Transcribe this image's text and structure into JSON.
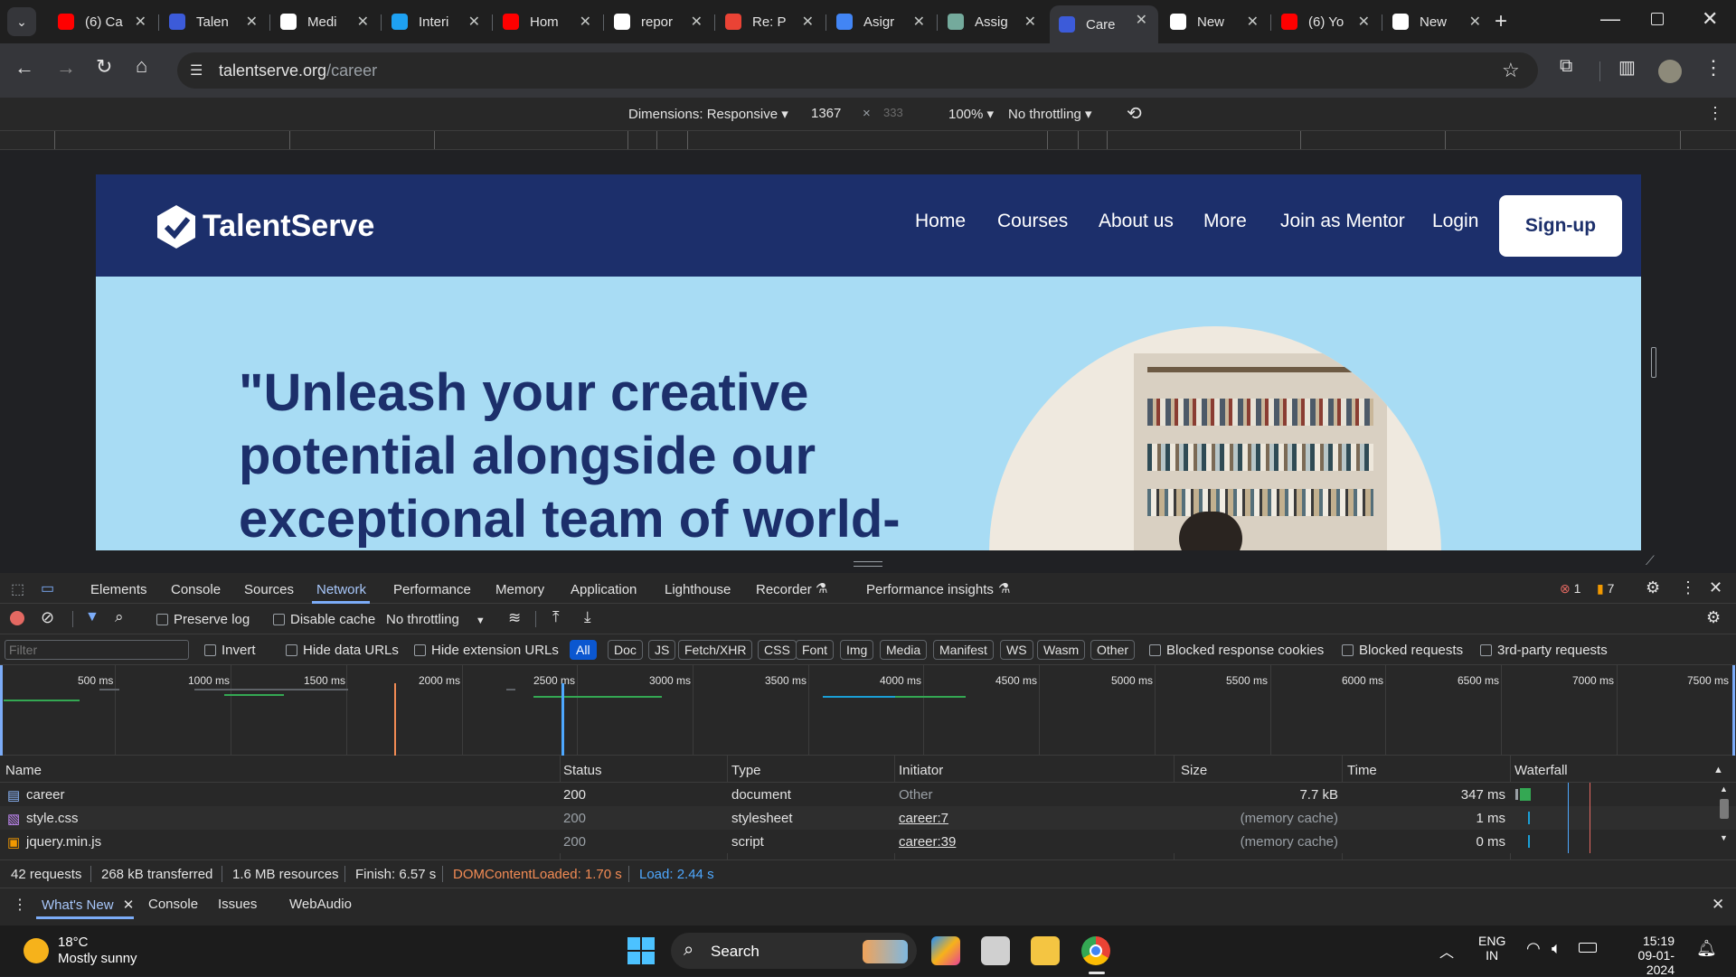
{
  "browser": {
    "tabs": [
      {
        "label": "(6) Ca",
        "icon": "youtube-icon",
        "color": "#ff0000"
      },
      {
        "label": "Talen",
        "icon": "talentserve-icon",
        "color": "#3c5bd9"
      },
      {
        "label": "Medi",
        "icon": "medium-icon",
        "color": "#ffffff"
      },
      {
        "label": "Interi",
        "icon": "internshala-icon",
        "color": "#1ea1f2"
      },
      {
        "label": "Hom",
        "icon": "youtube-icon",
        "color": "#ff0000"
      },
      {
        "label": "repor",
        "icon": "google-icon",
        "color": "#ffffff"
      },
      {
        "label": "Re: P",
        "icon": "gmail-icon",
        "color": "#ea4335"
      },
      {
        "label": "Asigr",
        "icon": "docs-icon",
        "color": "#4285f4"
      },
      {
        "label": "Assig",
        "icon": "chatgpt-icon",
        "color": "#74aa9c"
      },
      {
        "label": "Care",
        "icon": "talentserve-icon",
        "color": "#3c5bd9",
        "active": true
      },
      {
        "label": "New",
        "icon": "chrome-icon",
        "color": "#ffffff"
      },
      {
        "label": "(6) Yo",
        "icon": "youtube-icon",
        "color": "#ff0000"
      },
      {
        "label": "New",
        "icon": "chrome-icon",
        "color": "#ffffff"
      }
    ],
    "url_domain": "talentserve.org",
    "url_path": "/career"
  },
  "device_toolbar": {
    "dimensions": "Dimensions: Responsive ▾",
    "width": "1367",
    "times": "×",
    "height_placeholder": "333",
    "zoom": "100% ▾",
    "throttle": "No throttling ▾"
  },
  "site": {
    "brand": "TalentServe",
    "nav": [
      "Home",
      "Courses",
      "About us",
      "More",
      "Join as Mentor",
      "Login"
    ],
    "signup": "Sign-up",
    "hero_line1": "\"Unleash your creative",
    "hero_line2": "potential alongside our",
    "hero_line3": "exceptional team of world-"
  },
  "devtools": {
    "tabs": [
      "Elements",
      "Console",
      "Sources",
      "Network",
      "Performance",
      "Memory",
      "Application",
      "Lighthouse",
      "Recorder",
      "Performance insights"
    ],
    "active_tab": "Network",
    "errors": "1",
    "warnings": "7",
    "toolbar": {
      "preserve_log": "Preserve log",
      "disable_cache": "Disable cache",
      "throttling": "No throttling"
    },
    "filter": {
      "placeholder": "Filter",
      "invert": "Invert",
      "hide_data": "Hide data URLs",
      "hide_ext": "Hide extension URLs",
      "types": [
        "All",
        "Doc",
        "JS",
        "Fetch/XHR",
        "CSS",
        "Font",
        "Img",
        "Media",
        "Manifest",
        "WS",
        "Wasm",
        "Other"
      ],
      "blocked_cookies": "Blocked response cookies",
      "blocked_requests": "Blocked requests",
      "third_party": "3rd-party requests"
    },
    "timeline_labels": [
      "500 ms",
      "1000 ms",
      "1500 ms",
      "2000 ms",
      "2500 ms",
      "3000 ms",
      "3500 ms",
      "4000 ms",
      "4500 ms",
      "5000 ms",
      "5500 ms",
      "6000 ms",
      "6500 ms",
      "7000 ms",
      "7500 ms"
    ],
    "columns": [
      "Name",
      "Status",
      "Type",
      "Initiator",
      "Size",
      "Time",
      "Waterfall"
    ],
    "rows": [
      {
        "name": "career",
        "status": "200",
        "type": "document",
        "initiator": "Other",
        "size": "7.7 kB",
        "time": "347 ms",
        "icon": "document-icon"
      },
      {
        "name": "style.css",
        "status": "200",
        "type": "stylesheet",
        "initiator": "career:7",
        "size": "(memory cache)",
        "time": "1 ms",
        "icon": "css-file-icon"
      },
      {
        "name": "jquery.min.js",
        "status": "200",
        "type": "script",
        "initiator": "career:39",
        "size": "(memory cache)",
        "time": "0 ms",
        "icon": "js-file-icon"
      }
    ],
    "summary": {
      "requests": "42 requests",
      "transferred": "268 kB transferred",
      "resources": "1.6 MB resources",
      "finish": "Finish: 6.57 s",
      "dcl": "DOMContentLoaded: 1.70 s",
      "load": "Load: 2.44 s"
    },
    "drawer_tabs": [
      "What's New",
      "Console",
      "Issues",
      "WebAudio"
    ]
  },
  "taskbar": {
    "temp": "18°C",
    "weather": "Mostly sunny",
    "search": "Search",
    "lang1": "ENG",
    "lang2": "IN",
    "time": "15:19",
    "date": "09-01-2024"
  },
  "colors": {
    "brand_navy": "#1c2f6b",
    "hero_bg": "#a8dcf4",
    "accent_blue": "#0b57d0",
    "dcl_orange": "#f28b54",
    "load_blue": "#4ea8ff"
  }
}
